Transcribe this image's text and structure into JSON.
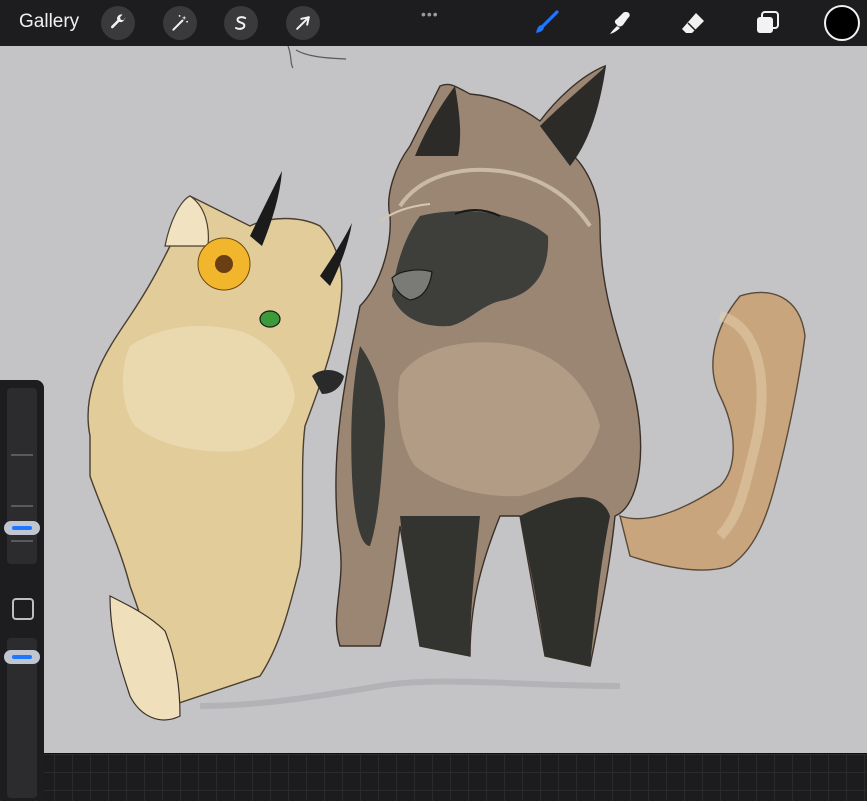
{
  "topbar": {
    "gallery_label": "Gallery",
    "left_tools": [
      {
        "name": "actions",
        "icon": "wrench-icon"
      },
      {
        "name": "adjustments",
        "icon": "magic-wand-icon"
      },
      {
        "name": "selection",
        "icon": "selection-s-icon"
      },
      {
        "name": "transform",
        "icon": "arrow-cursor-icon"
      }
    ],
    "more_label": "•••",
    "right_tools": [
      {
        "name": "brush",
        "icon": "brush-icon",
        "active": true
      },
      {
        "name": "smudge",
        "icon": "smudge-icon"
      },
      {
        "name": "eraser",
        "icon": "eraser-icon"
      },
      {
        "name": "layers",
        "icon": "layers-icon"
      }
    ],
    "current_color": "#000000",
    "accent_color": "#1f76ff"
  },
  "sidebar": {
    "brush_size_level": 0.18,
    "opacity_level": 0.92
  },
  "canvas": {
    "background": "#c4c4c7",
    "artwork": "illustration-two-wolves"
  }
}
